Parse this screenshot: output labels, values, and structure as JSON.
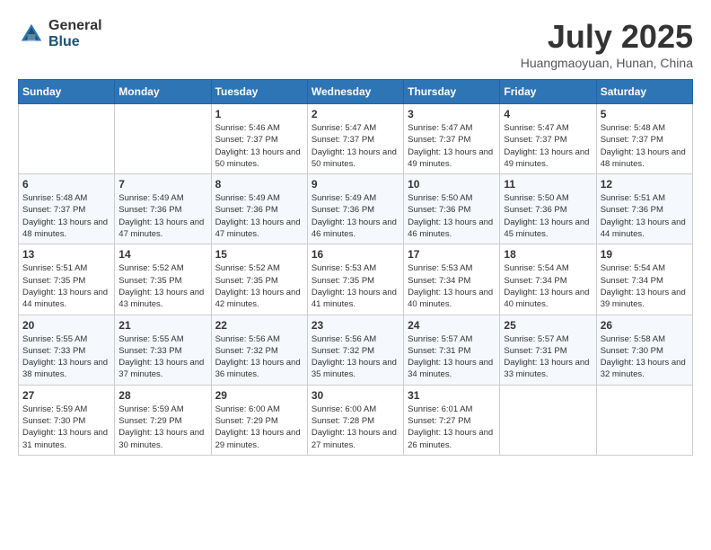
{
  "header": {
    "logo_general": "General",
    "logo_blue": "Blue",
    "month_title": "July 2025",
    "location": "Huangmaoyuan, Hunan, China"
  },
  "days_of_week": [
    "Sunday",
    "Monday",
    "Tuesday",
    "Wednesday",
    "Thursday",
    "Friday",
    "Saturday"
  ],
  "weeks": [
    [
      {
        "day": "",
        "sunrise": "",
        "sunset": "",
        "daylight": ""
      },
      {
        "day": "",
        "sunrise": "",
        "sunset": "",
        "daylight": ""
      },
      {
        "day": "1",
        "sunrise": "Sunrise: 5:46 AM",
        "sunset": "Sunset: 7:37 PM",
        "daylight": "Daylight: 13 hours and 50 minutes."
      },
      {
        "day": "2",
        "sunrise": "Sunrise: 5:47 AM",
        "sunset": "Sunset: 7:37 PM",
        "daylight": "Daylight: 13 hours and 50 minutes."
      },
      {
        "day": "3",
        "sunrise": "Sunrise: 5:47 AM",
        "sunset": "Sunset: 7:37 PM",
        "daylight": "Daylight: 13 hours and 49 minutes."
      },
      {
        "day": "4",
        "sunrise": "Sunrise: 5:47 AM",
        "sunset": "Sunset: 7:37 PM",
        "daylight": "Daylight: 13 hours and 49 minutes."
      },
      {
        "day": "5",
        "sunrise": "Sunrise: 5:48 AM",
        "sunset": "Sunset: 7:37 PM",
        "daylight": "Daylight: 13 hours and 48 minutes."
      }
    ],
    [
      {
        "day": "6",
        "sunrise": "Sunrise: 5:48 AM",
        "sunset": "Sunset: 7:37 PM",
        "daylight": "Daylight: 13 hours and 48 minutes."
      },
      {
        "day": "7",
        "sunrise": "Sunrise: 5:49 AM",
        "sunset": "Sunset: 7:36 PM",
        "daylight": "Daylight: 13 hours and 47 minutes."
      },
      {
        "day": "8",
        "sunrise": "Sunrise: 5:49 AM",
        "sunset": "Sunset: 7:36 PM",
        "daylight": "Daylight: 13 hours and 47 minutes."
      },
      {
        "day": "9",
        "sunrise": "Sunrise: 5:49 AM",
        "sunset": "Sunset: 7:36 PM",
        "daylight": "Daylight: 13 hours and 46 minutes."
      },
      {
        "day": "10",
        "sunrise": "Sunrise: 5:50 AM",
        "sunset": "Sunset: 7:36 PM",
        "daylight": "Daylight: 13 hours and 46 minutes."
      },
      {
        "day": "11",
        "sunrise": "Sunrise: 5:50 AM",
        "sunset": "Sunset: 7:36 PM",
        "daylight": "Daylight: 13 hours and 45 minutes."
      },
      {
        "day": "12",
        "sunrise": "Sunrise: 5:51 AM",
        "sunset": "Sunset: 7:36 PM",
        "daylight": "Daylight: 13 hours and 44 minutes."
      }
    ],
    [
      {
        "day": "13",
        "sunrise": "Sunrise: 5:51 AM",
        "sunset": "Sunset: 7:35 PM",
        "daylight": "Daylight: 13 hours and 44 minutes."
      },
      {
        "day": "14",
        "sunrise": "Sunrise: 5:52 AM",
        "sunset": "Sunset: 7:35 PM",
        "daylight": "Daylight: 13 hours and 43 minutes."
      },
      {
        "day": "15",
        "sunrise": "Sunrise: 5:52 AM",
        "sunset": "Sunset: 7:35 PM",
        "daylight": "Daylight: 13 hours and 42 minutes."
      },
      {
        "day": "16",
        "sunrise": "Sunrise: 5:53 AM",
        "sunset": "Sunset: 7:35 PM",
        "daylight": "Daylight: 13 hours and 41 minutes."
      },
      {
        "day": "17",
        "sunrise": "Sunrise: 5:53 AM",
        "sunset": "Sunset: 7:34 PM",
        "daylight": "Daylight: 13 hours and 40 minutes."
      },
      {
        "day": "18",
        "sunrise": "Sunrise: 5:54 AM",
        "sunset": "Sunset: 7:34 PM",
        "daylight": "Daylight: 13 hours and 40 minutes."
      },
      {
        "day": "19",
        "sunrise": "Sunrise: 5:54 AM",
        "sunset": "Sunset: 7:34 PM",
        "daylight": "Daylight: 13 hours and 39 minutes."
      }
    ],
    [
      {
        "day": "20",
        "sunrise": "Sunrise: 5:55 AM",
        "sunset": "Sunset: 7:33 PM",
        "daylight": "Daylight: 13 hours and 38 minutes."
      },
      {
        "day": "21",
        "sunrise": "Sunrise: 5:55 AM",
        "sunset": "Sunset: 7:33 PM",
        "daylight": "Daylight: 13 hours and 37 minutes."
      },
      {
        "day": "22",
        "sunrise": "Sunrise: 5:56 AM",
        "sunset": "Sunset: 7:32 PM",
        "daylight": "Daylight: 13 hours and 36 minutes."
      },
      {
        "day": "23",
        "sunrise": "Sunrise: 5:56 AM",
        "sunset": "Sunset: 7:32 PM",
        "daylight": "Daylight: 13 hours and 35 minutes."
      },
      {
        "day": "24",
        "sunrise": "Sunrise: 5:57 AM",
        "sunset": "Sunset: 7:31 PM",
        "daylight": "Daylight: 13 hours and 34 minutes."
      },
      {
        "day": "25",
        "sunrise": "Sunrise: 5:57 AM",
        "sunset": "Sunset: 7:31 PM",
        "daylight": "Daylight: 13 hours and 33 minutes."
      },
      {
        "day": "26",
        "sunrise": "Sunrise: 5:58 AM",
        "sunset": "Sunset: 7:30 PM",
        "daylight": "Daylight: 13 hours and 32 minutes."
      }
    ],
    [
      {
        "day": "27",
        "sunrise": "Sunrise: 5:59 AM",
        "sunset": "Sunset: 7:30 PM",
        "daylight": "Daylight: 13 hours and 31 minutes."
      },
      {
        "day": "28",
        "sunrise": "Sunrise: 5:59 AM",
        "sunset": "Sunset: 7:29 PM",
        "daylight": "Daylight: 13 hours and 30 minutes."
      },
      {
        "day": "29",
        "sunrise": "Sunrise: 6:00 AM",
        "sunset": "Sunset: 7:29 PM",
        "daylight": "Daylight: 13 hours and 29 minutes."
      },
      {
        "day": "30",
        "sunrise": "Sunrise: 6:00 AM",
        "sunset": "Sunset: 7:28 PM",
        "daylight": "Daylight: 13 hours and 27 minutes."
      },
      {
        "day": "31",
        "sunrise": "Sunrise: 6:01 AM",
        "sunset": "Sunset: 7:27 PM",
        "daylight": "Daylight: 13 hours and 26 minutes."
      },
      {
        "day": "",
        "sunrise": "",
        "sunset": "",
        "daylight": ""
      },
      {
        "day": "",
        "sunrise": "",
        "sunset": "",
        "daylight": ""
      }
    ]
  ]
}
